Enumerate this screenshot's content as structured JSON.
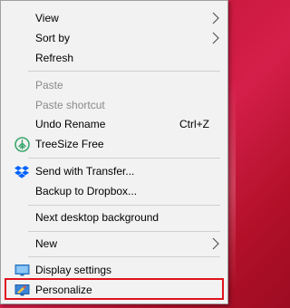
{
  "menu": {
    "items": [
      {
        "label": "View"
      },
      {
        "label": "Sort by"
      },
      {
        "label": "Refresh"
      },
      {
        "label": "Paste"
      },
      {
        "label": "Paste shortcut"
      },
      {
        "label": "Undo Rename",
        "shortcut": "Ctrl+Z"
      },
      {
        "label": "TreeSize Free"
      },
      {
        "label": "Send with Transfer..."
      },
      {
        "label": "Backup to Dropbox..."
      },
      {
        "label": "Next desktop background"
      },
      {
        "label": "New"
      },
      {
        "label": "Display settings"
      },
      {
        "label": "Personalize"
      }
    ]
  },
  "colors": {
    "menu_background": "#f2f2f2",
    "disabled_text": "#8a8a8a",
    "highlight_border": "#e0131e",
    "treesize_green": "#3aa76d",
    "dropbox_blue": "#0061fe"
  },
  "icons": {
    "treesize": "treesize-icon",
    "dropbox": "dropbox-icon",
    "display": "display-settings-icon",
    "personalize": "personalize-icon",
    "submenu": "chevron-right-icon"
  }
}
